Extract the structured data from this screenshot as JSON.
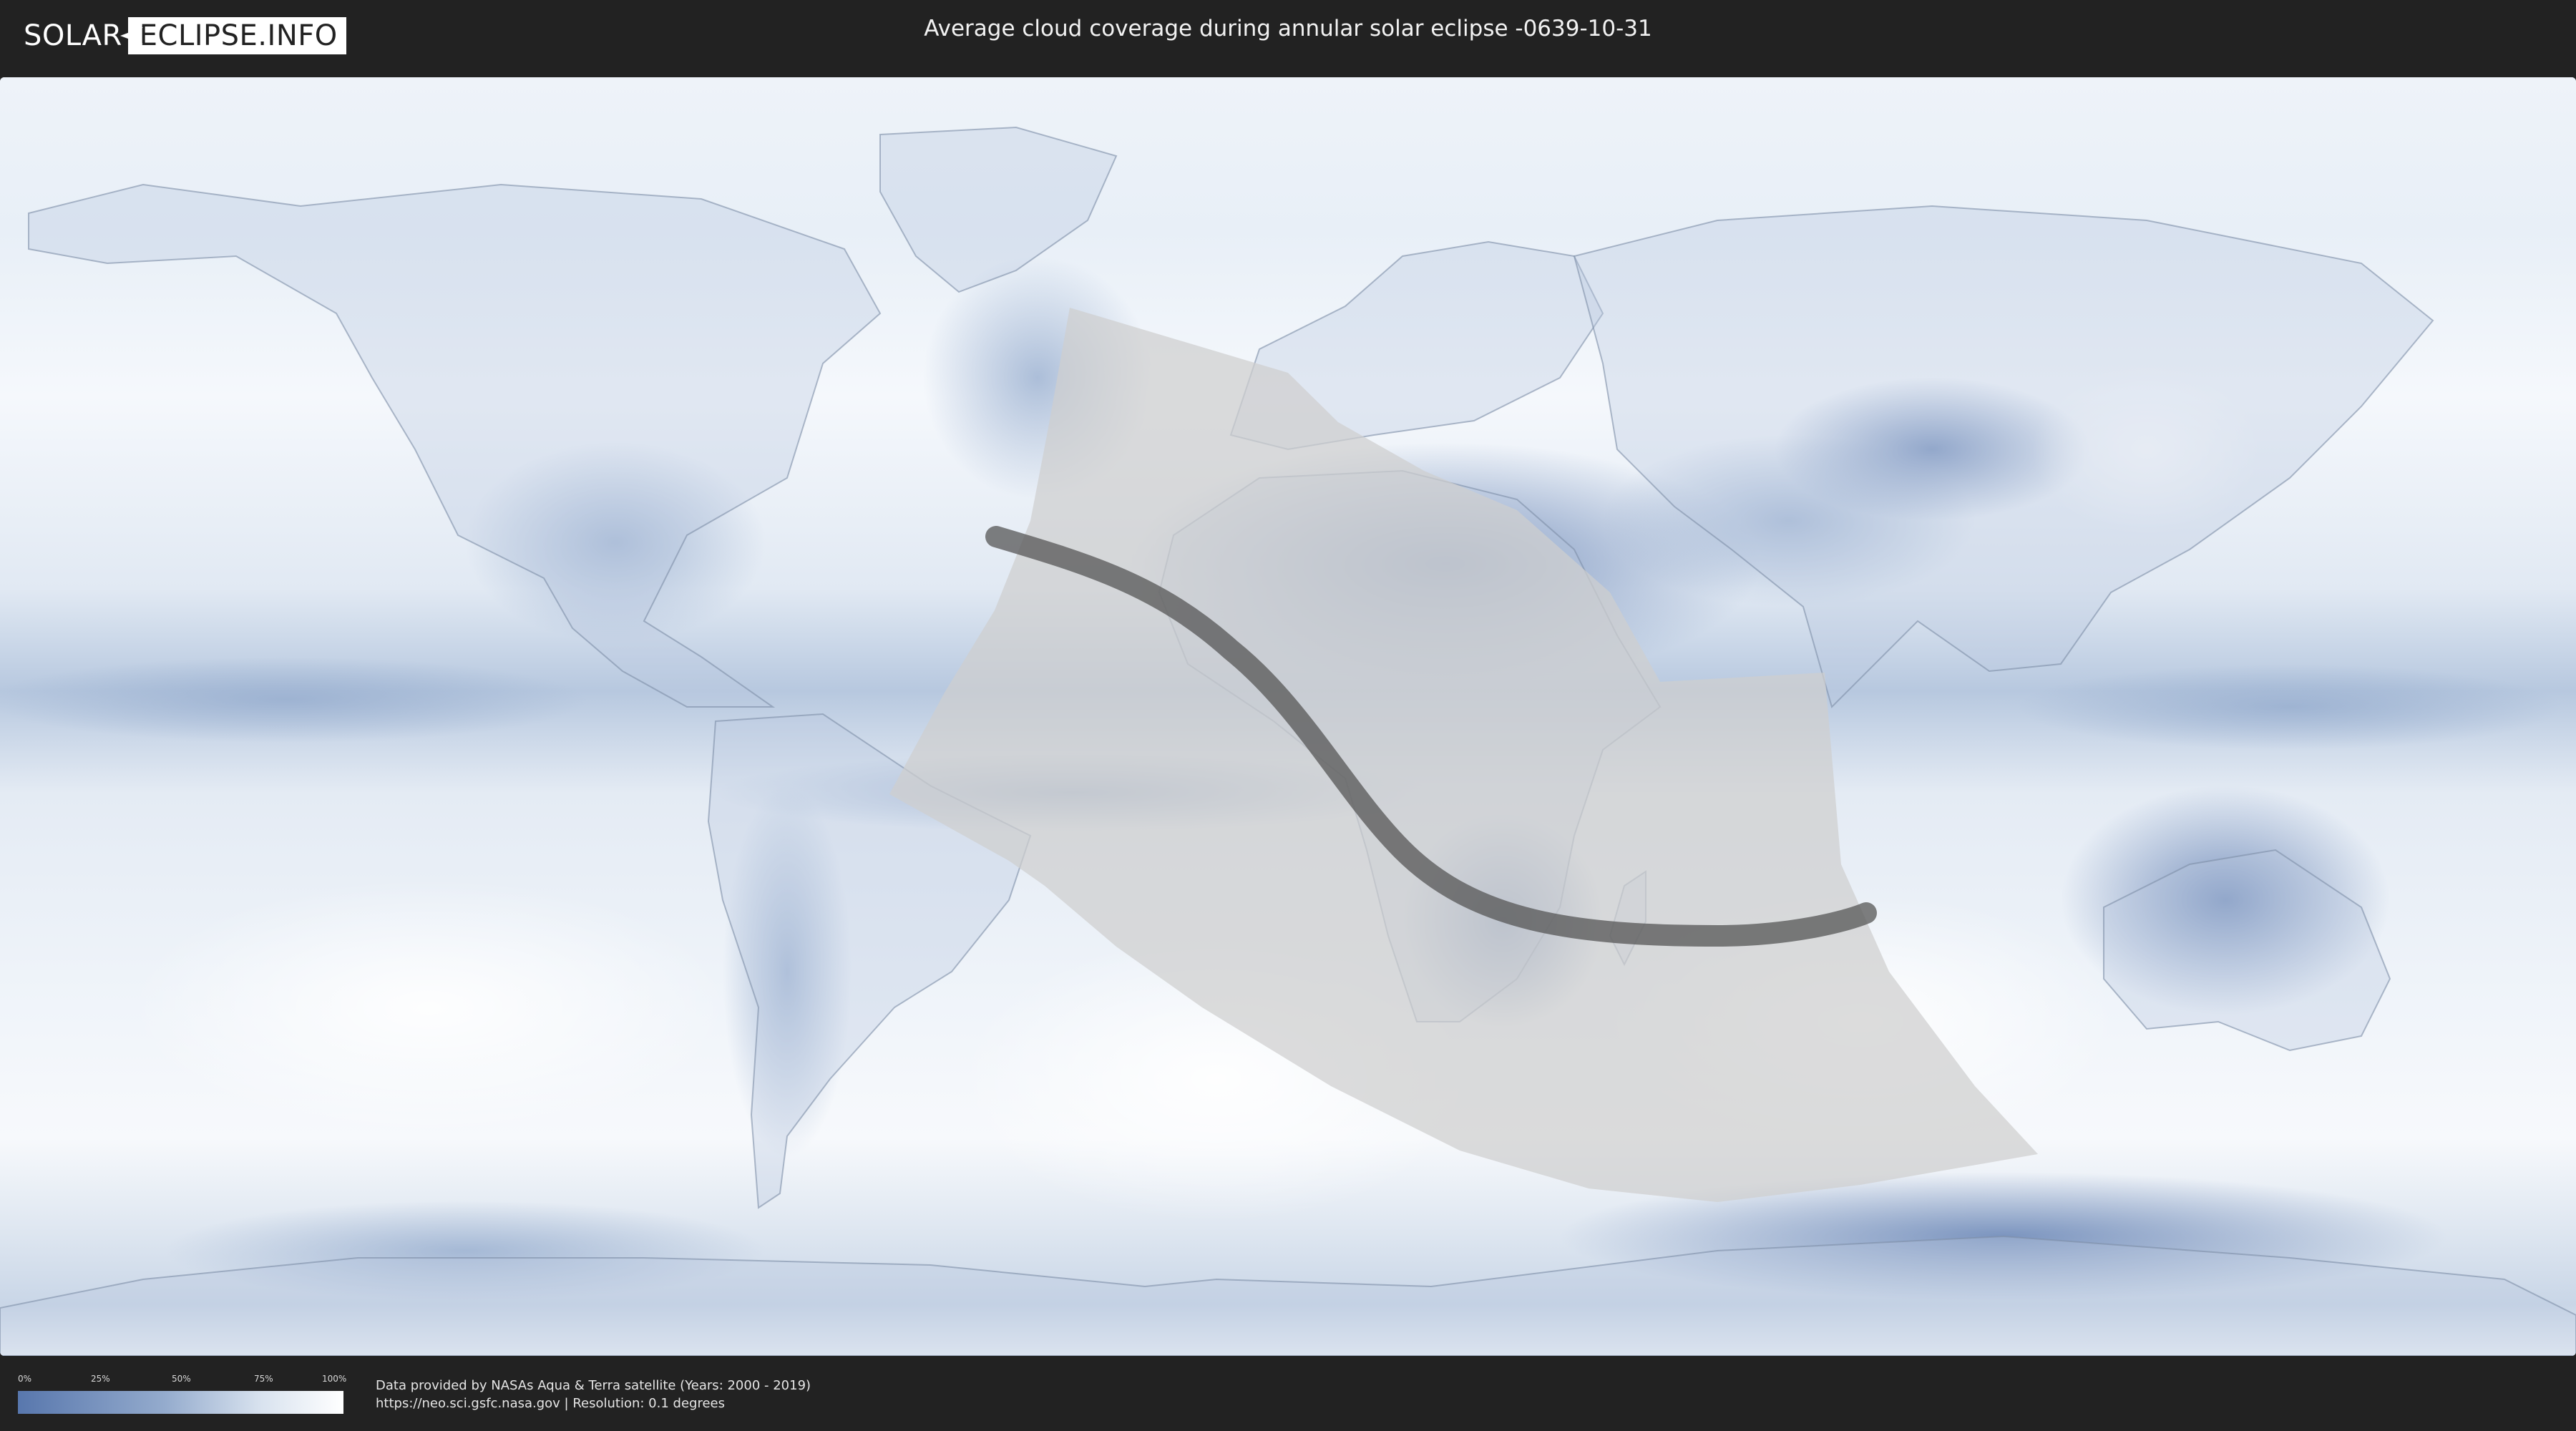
{
  "logo": {
    "left_text": "SOLAR",
    "right_text": "ECLIPSE.INFO"
  },
  "title": "Average cloud coverage during annular solar eclipse -0639-10-31",
  "map": {
    "colors": {
      "cloud_low": "#5877ad",
      "cloud_mid": "#94abcd",
      "cloud_high": "#ffffff",
      "eclipse_zone": "#cccccc",
      "central_path": "#555555"
    }
  },
  "legend": {
    "ticks": [
      "0%",
      "25%",
      "50%",
      "75%",
      "100%"
    ]
  },
  "credits": {
    "line1": "Data provided by NASAs Aqua & Terra satellite (Years: 2000 - 2019)",
    "line2": "https://neo.sci.gsfc.nasa.gov | Resolution: 0.1 degrees"
  }
}
